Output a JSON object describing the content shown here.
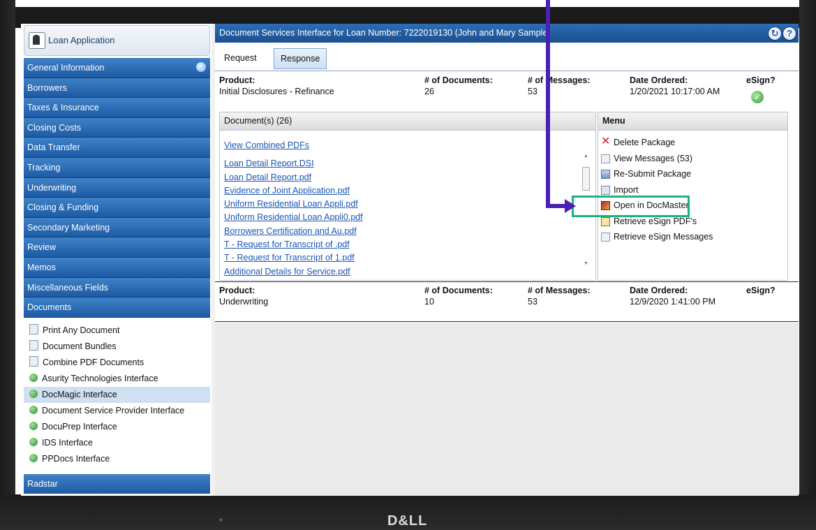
{
  "sidebar": {
    "app_title": "Loan Application",
    "nav": [
      "General Information",
      "Borrowers",
      "Taxes & Insurance",
      "Closing Costs",
      "Data Transfer",
      "Tracking",
      "Underwriting",
      "Closing & Funding",
      "Secondary Marketing",
      "Review",
      "Memos",
      "Miscellaneous Fields",
      "Documents"
    ],
    "documents": [
      {
        "label": "Print Any Document",
        "icon": "document-icon"
      },
      {
        "label": "Document Bundles",
        "icon": "document-icon"
      },
      {
        "label": "Combine PDF Documents",
        "icon": "document-icon"
      },
      {
        "label": "Asurity Technologies Interface",
        "icon": "green-status-icon"
      },
      {
        "label": "DocMagic Interface",
        "icon": "green-status-icon"
      },
      {
        "label": "Document Service Provider Interface",
        "icon": "green-status-icon"
      },
      {
        "label": "DocuPrep Interface",
        "icon": "green-status-icon"
      },
      {
        "label": "IDS Interface",
        "icon": "green-status-icon"
      },
      {
        "label": "PPDocs Interface",
        "icon": "green-status-icon"
      }
    ],
    "radstar": "Radstar"
  },
  "main": {
    "title": "Document Services Interface for Loan Number: 7222019130 (John and Mary Sample)",
    "tabs": [
      "Request",
      "Response"
    ],
    "headers": {
      "product": "Product:",
      "num_docs": "# of Documents:",
      "num_msgs": "# of Messages:",
      "date_ordered": "Date Ordered:",
      "esign": "eSign?"
    },
    "packages": [
      {
        "product": "Initial Disclosures - Refinance",
        "docs": "26",
        "msgs": "53",
        "date": "1/20/2021 10:17:00 AM"
      },
      {
        "product": "Underwriting",
        "docs": "10",
        "msgs": "53",
        "date": "12/9/2020 1:41:00 PM"
      }
    ],
    "documents_header": "Document(s) (26)",
    "documents": [
      "View Combined PDFs",
      "Loan Detail Report.DSI",
      "Loan Detail Report.pdf",
      "Evidence of Joint Application.pdf",
      "Uniform Residential Loan Appli.pdf",
      "Uniform Residential Loan Appli0.pdf",
      "Borrowers Certification and Au.pdf",
      "T - Request for Transcript of .pdf",
      "T - Request for Transcript of 1.pdf",
      "Additional Details for Service.pdf"
    ],
    "menu_header": "Menu",
    "menu": [
      {
        "label": "Delete Package",
        "icon": "delete-x-icon"
      },
      {
        "label": "View Messages (53)",
        "icon": "page-icon"
      },
      {
        "label": "Re-Submit Package",
        "icon": "resubmit-icon"
      },
      {
        "label": "Import",
        "icon": "import-icon"
      },
      {
        "label": "Open in DocMaster",
        "icon": "docmaster-icon"
      },
      {
        "label": "Retrieve eSign PDF's",
        "icon": "esign-icon"
      },
      {
        "label": "Retrieve eSign Messages",
        "icon": "page-icon"
      }
    ]
  },
  "device": {
    "brand": "D&LL"
  },
  "colors": {
    "nav_blue": "#1d5aa3",
    "title_blue": "#1b4f8f",
    "highlight": "#1ab37d",
    "arrow": "#4a1fb3",
    "link": "#1a56b5"
  }
}
